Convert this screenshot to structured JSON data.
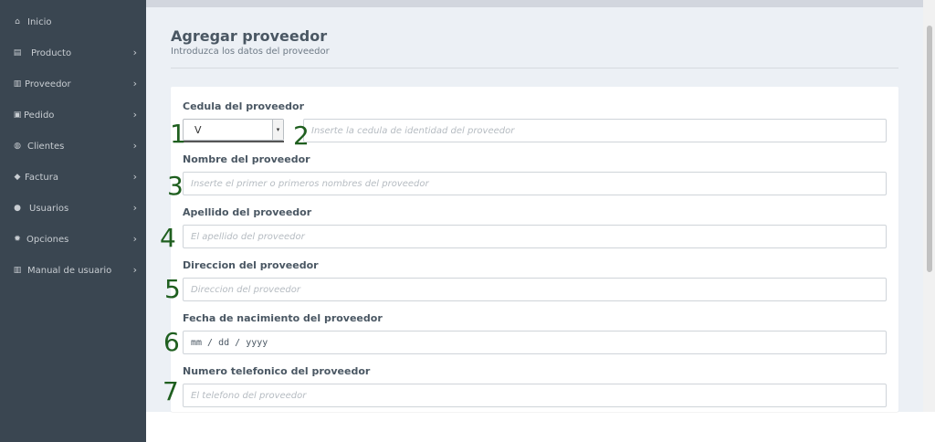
{
  "sidebar": {
    "items": [
      {
        "label": "Inicio",
        "icon": "home-icon",
        "glyph": "⌂",
        "chevron": ""
      },
      {
        "label": "Producto",
        "icon": "basket-icon",
        "glyph": "▤",
        "chevron": "›"
      },
      {
        "label": "Proveedor",
        "icon": "book-icon",
        "glyph": "▥",
        "chevron": "›"
      },
      {
        "label": "Pedido",
        "icon": "gift-icon",
        "glyph": "▣",
        "chevron": "›"
      },
      {
        "label": "Clientes",
        "icon": "handshake-icon",
        "glyph": "◍",
        "chevron": "›"
      },
      {
        "label": "Factura",
        "icon": "tag-icon",
        "glyph": "◆",
        "chevron": "›"
      },
      {
        "label": "Usuarios",
        "icon": "users-icon",
        "glyph": "●",
        "chevron": "›"
      },
      {
        "label": "Opciones",
        "icon": "gear-icon",
        "glyph": "✹",
        "chevron": "›"
      },
      {
        "label": "Manual de usuario",
        "icon": "book-icon",
        "glyph": "▥",
        "chevron": "›"
      }
    ]
  },
  "header": {
    "title": "Agregar proveedor",
    "subtitle": "Introduzca los datos del proveedor"
  },
  "form": {
    "cedula_label": "Cedula del proveedor",
    "cedula_select_value": "V",
    "cedula_placeholder": "Inserte la cedula de identidad del proveedor",
    "nombre_label": "Nombre del proveedor",
    "nombre_placeholder": "Inserte el primer o primeros nombres del proveedor",
    "apellido_label": "Apellido del proveedor",
    "apellido_placeholder": "El apellido del proveedor",
    "direccion_label": "Direccion del proveedor",
    "direccion_placeholder": "Direccion del proveedor",
    "fecha_label": "Fecha de nacimiento del proveedor",
    "fecha_value": "mm / dd / yyyy",
    "telefono_label": "Numero telefonico del proveedor",
    "telefono_placeholder": "El telefono del proveedor"
  },
  "markers": [
    "1",
    "2",
    "3",
    "4",
    "5",
    "6",
    "7"
  ],
  "colors": {
    "sidebar_bg": "#3a4651",
    "main_bg": "#ecf0f5",
    "marker": "#1f5f1f"
  }
}
